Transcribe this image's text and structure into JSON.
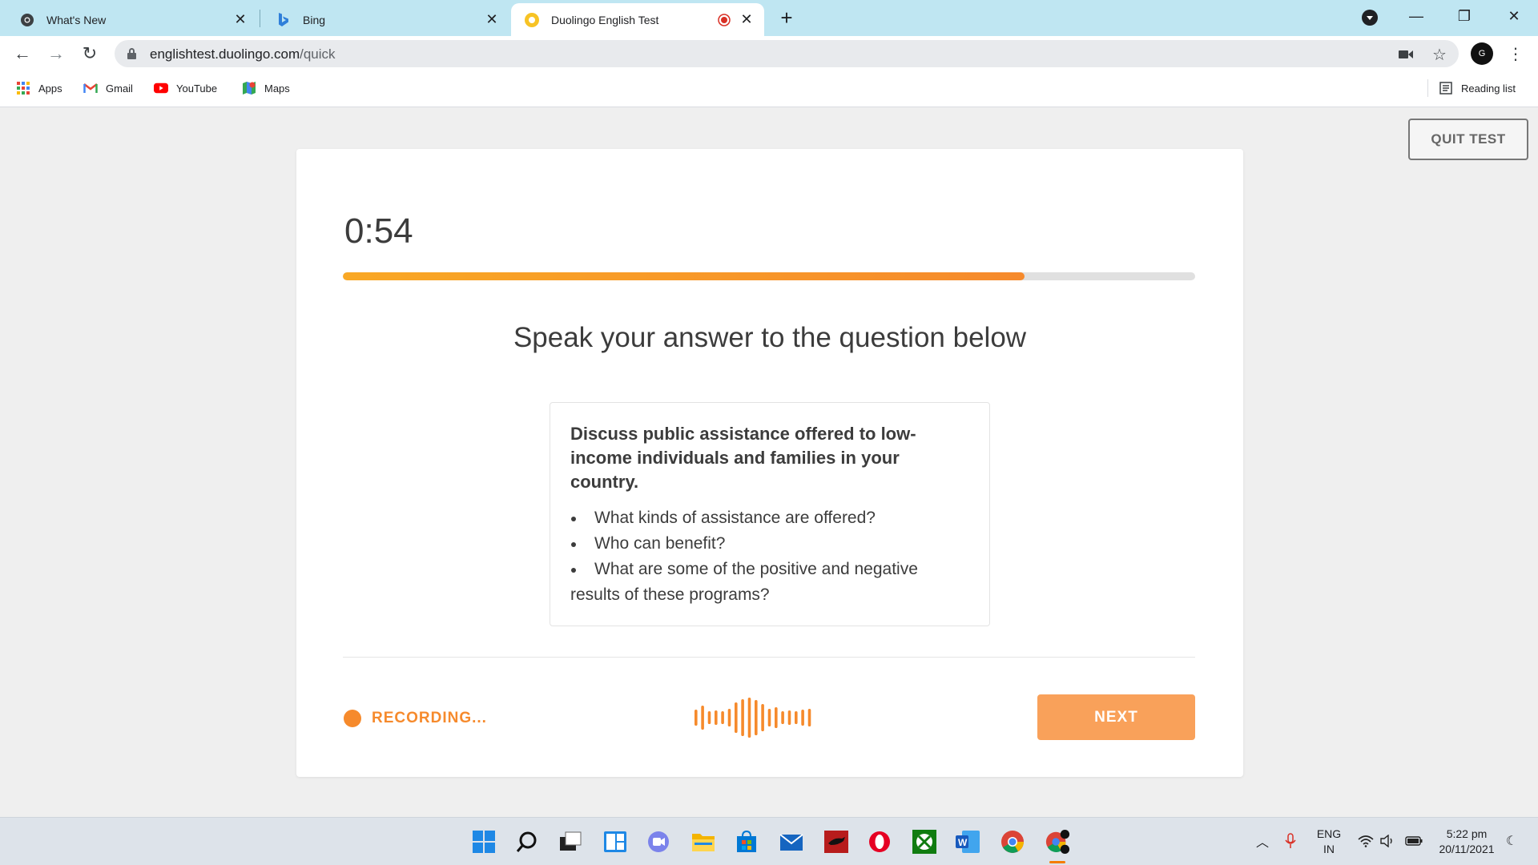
{
  "browser": {
    "tabs": [
      {
        "title": "What's New",
        "icon": "chrome-icon"
      },
      {
        "title": "Bing",
        "icon": "bing-icon"
      },
      {
        "title": "Duolingo English Test",
        "icon": "duolingo-icon",
        "active": true
      }
    ],
    "url_domain": "englishtest.duolingo.com",
    "url_path": "/quick",
    "bookmarks": [
      "Apps",
      "Gmail",
      "YouTube",
      "Maps"
    ],
    "reading_list": "Reading list",
    "profile_initial": "G"
  },
  "test": {
    "quit_label": "QUIT TEST",
    "timer": "0:54",
    "progress_percent": 80,
    "instruction": "Speak your answer to the question below",
    "question": "Discuss public assistance offered to low-income individuals and families in your country.",
    "bullets": [
      "What kinds of assistance are offered?",
      "Who can benefit?",
      "What are some of the positive and negative results of these programs?"
    ],
    "recording_label": "RECORDING...",
    "next_label": "NEXT",
    "accent_color": "#f68a2c"
  },
  "taskbar": {
    "apps": [
      "windows-start",
      "search",
      "task-view",
      "widgets",
      "teams-chat",
      "file-explorer",
      "microsoft-store",
      "mail",
      "app-red",
      "opera",
      "xbox",
      "word",
      "chrome",
      "chrome-active"
    ],
    "lang_line1": "ENG",
    "lang_line2": "IN",
    "time": "5:22 pm",
    "date": "20/11/2021"
  }
}
